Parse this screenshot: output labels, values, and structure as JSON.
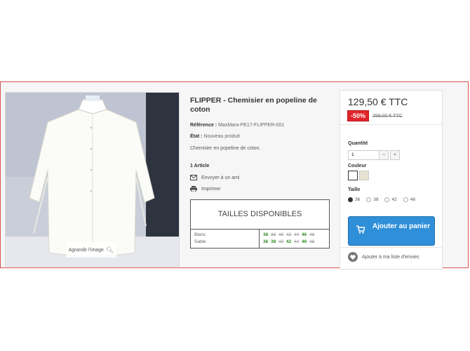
{
  "product": {
    "title": "FLIPPER - Chemisier en popeline de coton",
    "reference_label": "Référence :",
    "reference_value": "MaxMara-PE17-FLIPPER-001",
    "condition_label": "État :",
    "condition_value": "Nouveau produit",
    "short_description": "Chemisier en popeline de coton.",
    "stock_count": "1 Article",
    "send_friend": "Envoyer à un ami",
    "print": "Imprimer",
    "enlarge_image": "Agrandir l'image"
  },
  "sizes_table": {
    "title": "TAILLES DISPONIBLES",
    "rows": [
      {
        "label": "Blanc",
        "sizes": [
          {
            "n": "36",
            "available": true
          },
          {
            "n": "38",
            "available": false
          },
          {
            "n": "40",
            "available": false
          },
          {
            "n": "42",
            "available": false
          },
          {
            "n": "44",
            "available": false
          },
          {
            "n": "46",
            "available": true
          },
          {
            "n": "48",
            "available": false
          }
        ]
      },
      {
        "label": "Sable",
        "sizes": [
          {
            "n": "36",
            "available": true
          },
          {
            "n": "38",
            "available": true
          },
          {
            "n": "40",
            "available": false
          },
          {
            "n": "42",
            "available": true
          },
          {
            "n": "44",
            "available": false
          },
          {
            "n": "46",
            "available": true
          },
          {
            "n": "48",
            "available": false
          }
        ]
      }
    ]
  },
  "buy_box": {
    "price": "129,50 € TTC",
    "discount": "-50%",
    "old_price": "259,00 € TTC",
    "quantity_label": "Quantité",
    "quantity_value": "1",
    "minus": "−",
    "plus": "+",
    "color_label": "Couleur",
    "colors": [
      "#ffffff",
      "#e8e2d2"
    ],
    "size_label": "Taille",
    "size_options": [
      {
        "label": "36",
        "selected": true
      },
      {
        "label": "38",
        "selected": false
      },
      {
        "label": "42",
        "selected": false
      },
      {
        "label": "46",
        "selected": false
      }
    ],
    "add_to_cart": "Ajouter au panier",
    "wishlist": "Ajouter à ma liste d'envies"
  },
  "colors": {
    "accent_blue": "#2f8fd8",
    "discount_red": "#e0262c",
    "available_green": "#2e8b22",
    "band_border": "#d9534f"
  }
}
